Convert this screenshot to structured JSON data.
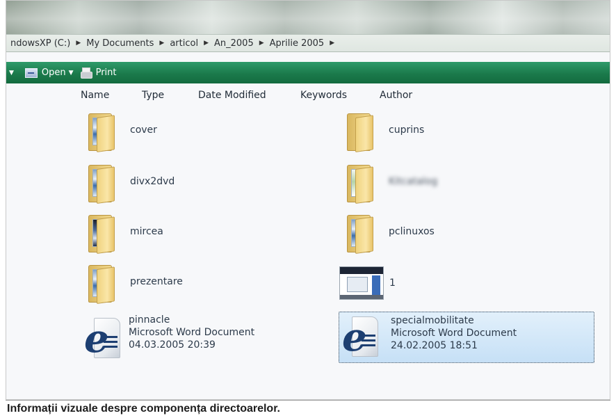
{
  "address": {
    "crumbs": [
      "ndowsXP (C:)",
      "My Documents",
      "articol",
      "An_2005",
      "Aprilie 2005"
    ]
  },
  "toolbar": {
    "open_label": "Open",
    "print_label": "Print"
  },
  "columns": [
    "Name",
    "Type",
    "Date Modified",
    "Keywords",
    "Author"
  ],
  "files": {
    "cover": "cover",
    "cuprins": "cuprins",
    "divx2dvd": "divx2dvd",
    "blurred": "Kitcatalog",
    "mircea": "mircea",
    "pclinuxos": "pclinuxos",
    "prezentare": "prezentare",
    "image1": "1",
    "pinnacle": {
      "name": "pinnacle",
      "type": "Microsoft Word Document",
      "date": "04.03.2005 20:39"
    },
    "special": {
      "name": "specialmobilitate",
      "type": "Microsoft Word Document",
      "date": "24.02.2005 18:51"
    }
  },
  "caption": "Informații vizuale despre componența directoarelor.",
  "colors": {
    "toolbar_green": "#1b7a4b",
    "selection": "#c6e0f6"
  }
}
